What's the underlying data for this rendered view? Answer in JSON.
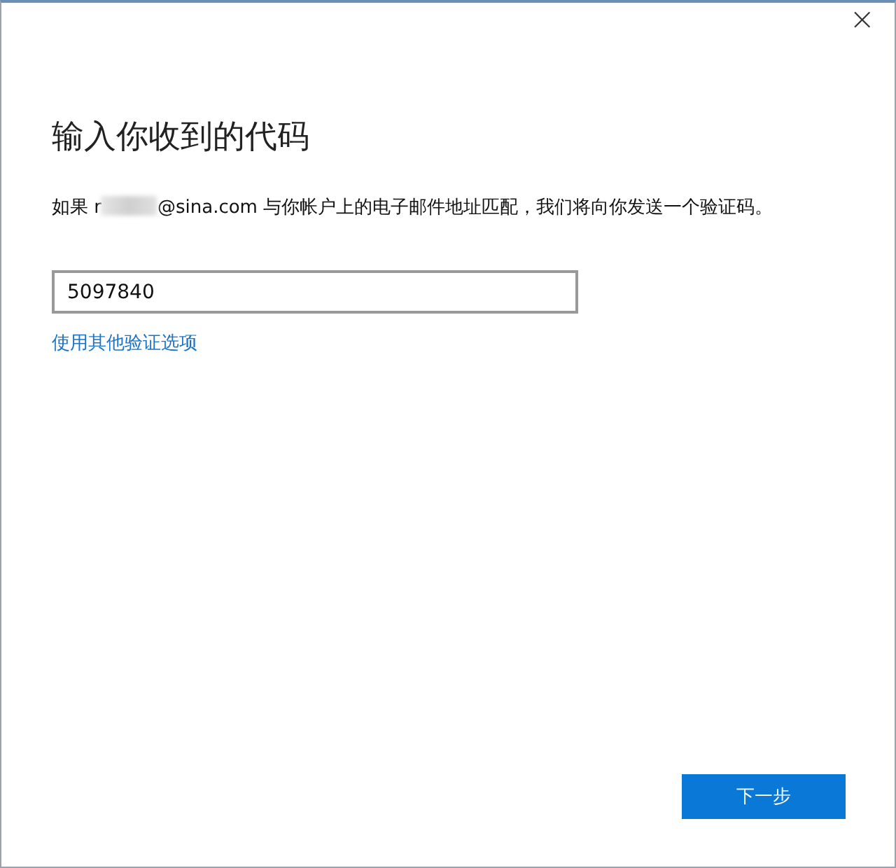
{
  "window": {
    "close": "×"
  },
  "heading": "输入你收到的代码",
  "description": {
    "before": "如果 r",
    "redacted": true,
    "after": "@sina.com 与你帐户上的电子邮件地址匹配，我们将向你发送一个验证码。"
  },
  "code_field": {
    "value": "5097840"
  },
  "link": "使用其他验证选项",
  "next_button": "下一步"
}
